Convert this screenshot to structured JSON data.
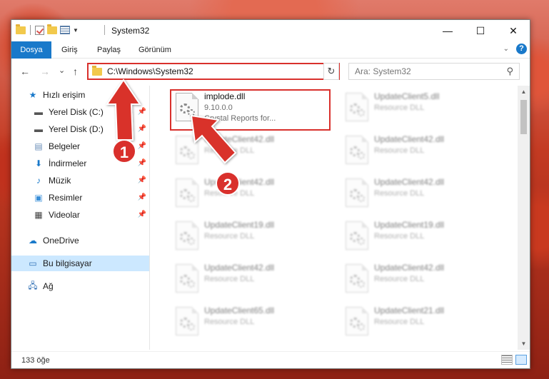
{
  "window": {
    "title": "System32",
    "controls": {
      "minimize": "—",
      "maximize": "☐",
      "close": "✕"
    }
  },
  "ribbon": {
    "tabs": [
      "Dosya",
      "Giriş",
      "Paylaş",
      "Görünüm"
    ],
    "help": "?"
  },
  "nav": {
    "back": "←",
    "forward": "→",
    "recent": "⌄",
    "up": "↑",
    "address": "C:\\Windows\\System32",
    "refresh": "↻",
    "search_placeholder": "Ara: System32",
    "search_icon": "⚲"
  },
  "sidebar": {
    "items": [
      {
        "label": "Hızlı erişim",
        "icon": "star-icon"
      },
      {
        "label": "Yerel Disk (C:)",
        "icon": "drive-icon",
        "pinned": true
      },
      {
        "label": "Yerel Disk (D:)",
        "icon": "drive-icon",
        "pinned": true
      },
      {
        "label": "Belgeler",
        "icon": "documents-icon",
        "pinned": true
      },
      {
        "label": "İndirmeler",
        "icon": "download-icon",
        "pinned": true
      },
      {
        "label": "Müzik",
        "icon": "music-icon",
        "pinned": true
      },
      {
        "label": "Resimler",
        "icon": "pictures-icon",
        "pinned": true
      },
      {
        "label": "Videolar",
        "icon": "videos-icon",
        "pinned": true
      },
      {
        "label": "OneDrive",
        "icon": "cloud-icon"
      },
      {
        "label": "Bu bilgisayar",
        "icon": "computer-icon",
        "selected": true
      },
      {
        "label": "Ağ",
        "icon": "network-icon"
      }
    ]
  },
  "files": {
    "highlighted": {
      "name": "implode.dll",
      "version": "9.10.0.0",
      "description": "Crystal Reports for..."
    },
    "col1": [
      {
        "name": "UpdateClient42.dll",
        "desc": "Resource DLL"
      },
      {
        "name": "UpdateClient42.dll",
        "desc": "Resource DLL"
      },
      {
        "name": "UpdateClient19.dll",
        "desc": "Resource DLL"
      },
      {
        "name": "UpdateClient42.dll",
        "desc": "Resource DLL"
      },
      {
        "name": "UpdateClient65.dll",
        "desc": "Resource DLL"
      }
    ],
    "col2": [
      {
        "name": "UpdateClient5.dll",
        "desc": "Resource DLL"
      },
      {
        "name": "UpdateClient42.dll",
        "desc": "Resource DLL"
      },
      {
        "name": "UpdateClient42.dll",
        "desc": "Resource DLL"
      },
      {
        "name": "UpdateClient19.dll",
        "desc": "Resource DLL"
      },
      {
        "name": "UpdateClient42.dll",
        "desc": "Resource DLL"
      },
      {
        "name": "UpdateClient21.dll",
        "desc": "Resource DLL"
      }
    ]
  },
  "status": {
    "count": "133 öğe"
  },
  "annotations": {
    "step1": "1",
    "step2": "2",
    "color": "#d9302c"
  }
}
